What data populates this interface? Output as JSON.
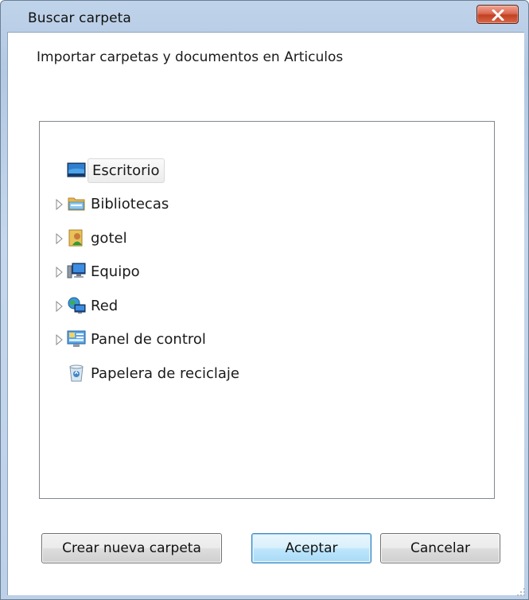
{
  "window": {
    "title": "Buscar carpeta",
    "close_icon": "close-x-icon"
  },
  "dialog": {
    "prompt": "Importar carpetas y documentos en Articulos"
  },
  "tree": {
    "items": [
      {
        "label": "Escritorio",
        "icon": "desktop-icon",
        "expandable": false,
        "selected": true
      },
      {
        "label": "Bibliotecas",
        "icon": "libraries-icon",
        "expandable": true,
        "selected": false
      },
      {
        "label": "gotel",
        "icon": "user-folder-icon",
        "expandable": true,
        "selected": false
      },
      {
        "label": "Equipo",
        "icon": "computer-icon",
        "expandable": true,
        "selected": false
      },
      {
        "label": "Red",
        "icon": "network-icon",
        "expandable": true,
        "selected": false
      },
      {
        "label": "Panel de control",
        "icon": "control-panel-icon",
        "expandable": true,
        "selected": false
      },
      {
        "label": "Papelera de reciclaje",
        "icon": "recycle-bin-icon",
        "expandable": false,
        "selected": false
      }
    ]
  },
  "buttons": {
    "new_folder": "Crear nueva carpeta",
    "ok": "Aceptar",
    "cancel": "Cancelar"
  },
  "colors": {
    "frame": "#bfd3ea",
    "close_button": "#c7432a",
    "default_button_border": "#3c7fb1"
  }
}
